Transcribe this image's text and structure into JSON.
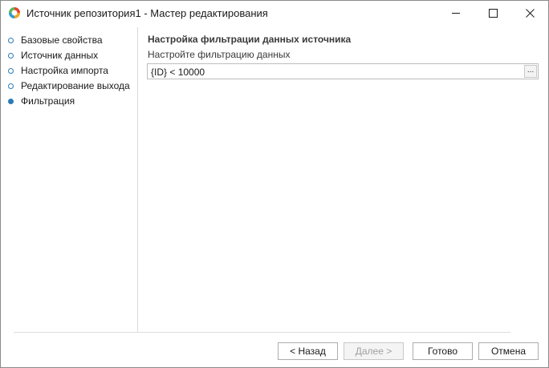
{
  "window": {
    "title": "Источник репозитория1 - Мастер редактирования",
    "app_icon": "wizard-app-icon",
    "controls": [
      "minimize-icon",
      "maximize-icon",
      "close-icon"
    ]
  },
  "nav": {
    "items": [
      {
        "label": "Базовые свойства",
        "active": false
      },
      {
        "label": "Источник данных",
        "active": false
      },
      {
        "label": "Настройка импорта",
        "active": false
      },
      {
        "label": "Редактирование выхода",
        "active": false
      },
      {
        "label": "Фильтрация",
        "active": true
      }
    ],
    "accent_color": "#2b7bb9"
  },
  "main": {
    "section_title": "Настройка фильтрации данных источника",
    "field_label": "Настройте фильтрацию данных",
    "filter_value": "{ID} < 10000",
    "ellipsis_label": "..."
  },
  "footer": {
    "back_label": "< Назад",
    "next_label": "Далее >",
    "done_label": "Готово",
    "cancel_label": "Отмена"
  }
}
